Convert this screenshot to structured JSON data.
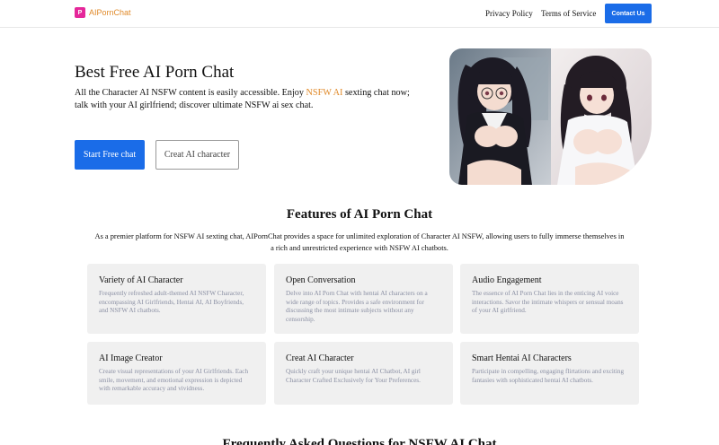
{
  "header": {
    "logo_mark": "P",
    "logo_text": "AIPornChat",
    "nav": {
      "privacy": "Privacy Policy",
      "terms": "Terms of Service",
      "contact": "Contact Us"
    }
  },
  "hero": {
    "title": "Best Free AI Porn Chat",
    "desc_before": "All the Character AI NSFW content is easily accessible. Enjoy ",
    "desc_highlight": "NSFW AI",
    "desc_after": " sexting chat now; talk with your AI girlfriend; discover ultimate NSFW ai sex chat.",
    "start_button": "Start Free chat",
    "creat_button": "Creat AI character"
  },
  "features": {
    "title": "Features of AI Porn Chat",
    "subtitle": "As a premier platform for NSFW AI sexting chat, AIPornChat provides a space for unlimited exploration of Character AI NSFW, allowing users to fully immerse themselves in a rich and unrestricted experience with NSFW AI chatbots.",
    "cards": [
      {
        "title": "Variety of AI Character",
        "text": "Frequently refreshed adult-themed AI NSFW Character, encompassing AI Girlfriends, Hentai AI, AI Boyfriends, and NSFW AI chatbots."
      },
      {
        "title": "Open Conversation",
        "text": "Delve into AI Porn Chat with hentai AI characters on a wide range of topics. Provides a safe environment for discussing the most intimate subjects without any censorship."
      },
      {
        "title": "Audio Engagement",
        "text": "The essence of AI Porn Chat lies in the enticing AI voice interactions. Savor the intimate whispers or sensual moans of your AI girlfriend."
      },
      {
        "title": "AI Image Creator",
        "text": "Create visual representations of your AI Girlfriends. Each smile, movement, and emotional expression is depicted with remarkable accuracy and vividness."
      },
      {
        "title": "Creat AI Character",
        "text": "Quickly craft your unique hentai AI Chatbot, AI girl Character Crafted Exclusively for Your Preferences."
      },
      {
        "title": "Smart Hentai AI Characters",
        "text": "Participate in compelling, engaging flirtations and exciting fantasies with sophisticated hentai AI chatbots."
      }
    ]
  },
  "faq": {
    "title": "Frequently Asked Questions for NSFW AI Chat"
  },
  "colors": {
    "accent": "#1a6ce8",
    "highlight": "#e08a2a",
    "logo": "#e5279a",
    "card_bg": "#f0f0f0",
    "card_text": "#8a8fa3"
  }
}
